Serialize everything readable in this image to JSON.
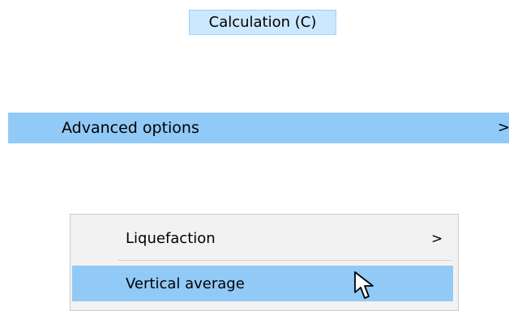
{
  "menu_bar": {
    "calculation_label": "Calculation (C)"
  },
  "submenu": {
    "advanced_options_label": "Advanced options",
    "advanced_options_arrow": ">"
  },
  "context_menu": {
    "items": [
      {
        "label": "Liquefaction",
        "arrow": ">"
      },
      {
        "label": "Vertical average"
      }
    ]
  },
  "colors": {
    "highlight": "#91c9f7",
    "menu_bar_selected": "#cce8ff",
    "menu_bar_selected_border": "#99d1ff",
    "menu_background": "#f2f2f2"
  },
  "icons": {
    "cursor": "mouse-pointer-icon"
  }
}
